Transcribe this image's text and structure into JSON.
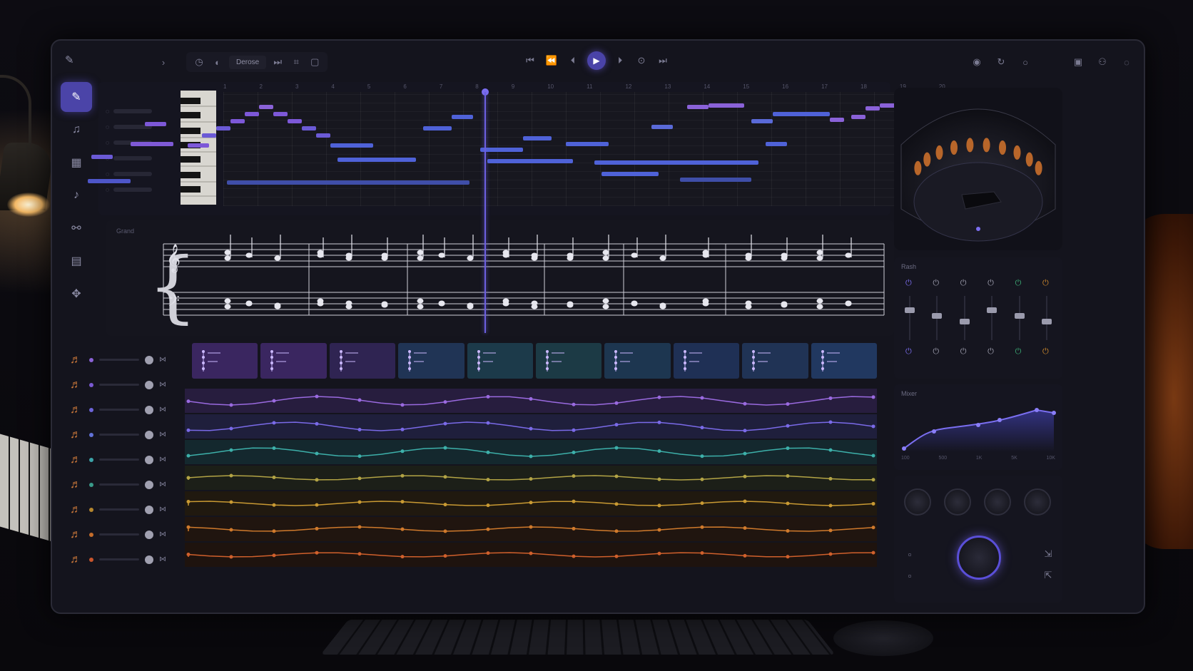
{
  "app": {
    "title_logo": "notation editor",
    "toolbar": {
      "tempo_label": "Derose",
      "icons": [
        "metronome-icon",
        "loop-icon",
        "record-mode-icon",
        "snap-icon",
        "quantize-icon"
      ]
    },
    "transport": {
      "buttons": [
        "skip-back-icon",
        "previous-bar-icon",
        "rewind-icon",
        "play-icon",
        "fast-forward-icon",
        "record-icon",
        "skip-end-icon"
      ]
    },
    "top_right": [
      "share-icon",
      "undo-icon",
      "settings-icon",
      "save-icon",
      "user-icon",
      "help-icon"
    ]
  },
  "tools": [
    {
      "name": "pencil-tool",
      "icon": "✎",
      "active": true
    },
    {
      "name": "note-tool",
      "icon": "♫",
      "active": false
    },
    {
      "name": "grid-tool",
      "icon": "▦",
      "active": false
    },
    {
      "name": "clef-tool",
      "icon": "𝄞",
      "active": false
    },
    {
      "name": "link-tool",
      "icon": "⚯",
      "active": false
    },
    {
      "name": "layout-tool",
      "icon": "▤",
      "active": false
    },
    {
      "name": "adjust-tool",
      "icon": "✥",
      "active": false
    }
  ],
  "piano_roll": {
    "ruler": [
      "1",
      "2",
      "3",
      "4",
      "5",
      "6",
      "7",
      "8",
      "9",
      "10",
      "11",
      "12",
      "13",
      "14",
      "15",
      "16",
      "17",
      "18",
      "19",
      "20"
    ]
  },
  "score": {
    "label": "Grand"
  },
  "tracks": [
    {
      "instrument": "violin-icon",
      "color": "#8a62d6"
    },
    {
      "instrument": "violin-icon",
      "color": "#7a5ad2"
    },
    {
      "instrument": "cello-icon",
      "color": "#6c64d8"
    },
    {
      "instrument": "flute-icon",
      "color": "#6272d8"
    },
    {
      "instrument": "clarinet-icon",
      "color": "#3ca3a8"
    },
    {
      "instrument": "horn-icon",
      "color": "#3a9b8a"
    },
    {
      "instrument": "trumpet-icon",
      "color": "#b5862e"
    },
    {
      "instrument": "trombone-icon",
      "color": "#c46d2b"
    },
    {
      "instrument": "timpani-icon",
      "color": "#c9552c"
    }
  ],
  "mixer": {
    "title": "Rash"
  },
  "eq": {
    "title": "Mixer",
    "labels": [
      "100",
      "500",
      "1K",
      "5K",
      "10K"
    ]
  },
  "colors": {
    "accent": "#6b5fe0",
    "violet": "#7d57d6",
    "blue": "#4f6bd8",
    "teal": "#3ca3a8",
    "orange": "#d0702c"
  }
}
